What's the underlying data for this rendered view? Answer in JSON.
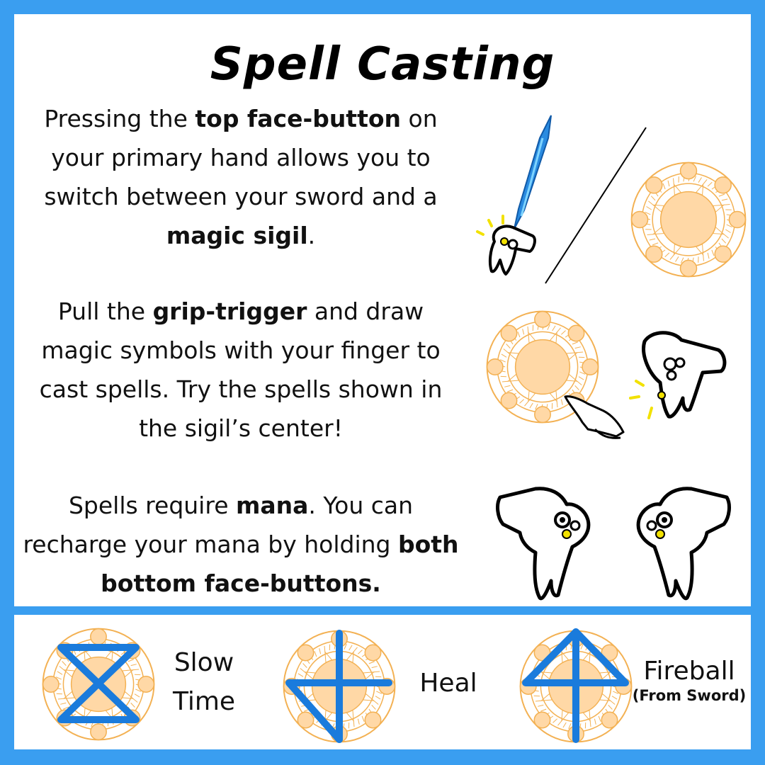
{
  "title": "Spell Casting",
  "instructions": [
    {
      "parts": [
        "Pressing the ",
        "top face-button",
        " on your primary hand allows you to switch between your sword and a ",
        "magic sigil",
        "."
      ]
    },
    {
      "parts": [
        "Pull the ",
        "grip-trigger",
        " and draw magic symbols with your finger to cast spells. Try the spells shown in the sigil’s center!"
      ]
    },
    {
      "parts": [
        "Spells require ",
        "mana",
        ". You can recharge your mana by holding ",
        "both bottom face-buttons."
      ]
    }
  ],
  "spells": [
    {
      "name_line1": "Slow",
      "name_line2": "Time",
      "symbol": "hourglass"
    },
    {
      "name": "Heal",
      "symbol": "cross-with-triangle"
    },
    {
      "name": "Fireball",
      "note": "(From Sword)",
      "symbol": "arrow-up"
    }
  ],
  "colors": {
    "frame": "#3a9ef0",
    "sigil_fill": "#ffd8a6",
    "sigil_stroke": "#f3b153",
    "spell_stroke": "#1a7bdc",
    "sword": "#2a8be0",
    "button_glow": "#f2e100"
  }
}
